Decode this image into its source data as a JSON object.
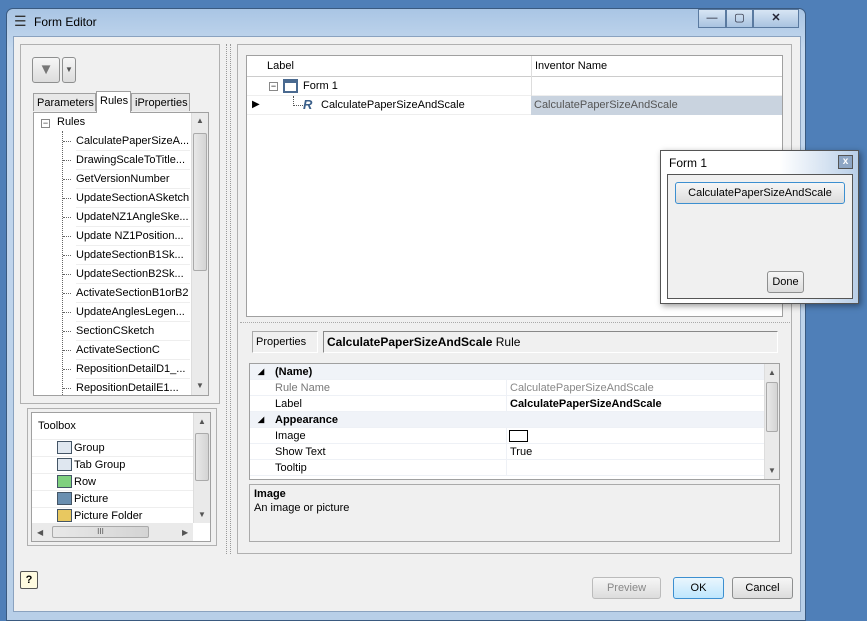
{
  "window": {
    "title": "Form Editor",
    "controls": [
      "—",
      "▢",
      "✕"
    ]
  },
  "left": {
    "tabs": [
      "Parameters",
      "Rules",
      "iProperties"
    ],
    "active_tab": "Rules",
    "tree_root": "Rules",
    "rules": [
      "CalculatePaperSizeA...",
      "DrawingScaleToTitle...",
      "GetVersionNumber",
      "UpdateSectionASketch",
      "UpdateNZ1AngleSke...",
      "Update NZ1Position...",
      "UpdateSectionB1Sk...",
      "UpdateSectionB2Sk...",
      "ActivateSectionB1orB2",
      "UpdateAnglesLegen...",
      "SectionCSketch",
      "ActivateSectionC",
      "RepositionDetailD1_...",
      "RepositionDetailE1..."
    ],
    "toolbox": {
      "header": "Toolbox",
      "items": [
        "Group",
        "Tab Group",
        "Row",
        "Picture",
        "Picture Folder"
      ],
      "hscroll_grip": "III"
    }
  },
  "form_tree": {
    "columns": [
      "Label",
      "Inventor Name"
    ],
    "rows": [
      {
        "label": "Form 1",
        "inventor_name": ""
      },
      {
        "label": "CalculatePaperSizeAndScale",
        "inventor_name": "CalculatePaperSizeAndScale"
      }
    ]
  },
  "preview_popup": {
    "title": "Form 1",
    "close": "x",
    "rule_button": "CalculatePaperSizeAndScale",
    "done": "Done"
  },
  "properties": {
    "label": "Properties",
    "selection_bold": "CalculatePaperSizeAndScale",
    "selection_suffix": " Rule",
    "rows": [
      {
        "type": "category",
        "name": "(Name)"
      },
      {
        "type": "prop",
        "name": "Rule Name",
        "value": "CalculatePaperSizeAndScale",
        "readonly": true
      },
      {
        "type": "prop",
        "name": "Label",
        "value": "CalculatePaperSizeAndScale",
        "bold": true
      },
      {
        "type": "category",
        "name": "Appearance"
      },
      {
        "type": "prop",
        "name": "Image",
        "value": ""
      },
      {
        "type": "prop",
        "name": "Show Text",
        "value": "True"
      },
      {
        "type": "prop",
        "name": "Tooltip",
        "value": ""
      }
    ],
    "description_title": "Image",
    "description_text": "An image or picture"
  },
  "footer": {
    "help": "?",
    "preview": "Preview",
    "ok": "OK",
    "cancel": "Cancel"
  },
  "colors": {
    "selection": "#c9d3df",
    "accent": "#3c8fd0"
  }
}
